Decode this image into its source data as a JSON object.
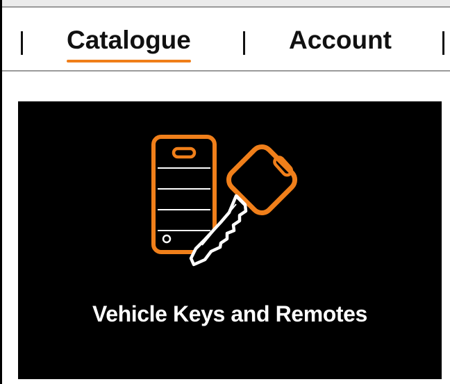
{
  "nav": {
    "separator": "|",
    "items": [
      {
        "label": "Catalogue",
        "active": true
      },
      {
        "label": "Account",
        "active": false
      }
    ]
  },
  "card": {
    "title": "Vehicle Keys and Remotes",
    "icon": "key-and-remote-icon"
  },
  "colors": {
    "accent": "#f07f1a",
    "card_background": "#000000",
    "card_text": "#ffffff"
  }
}
